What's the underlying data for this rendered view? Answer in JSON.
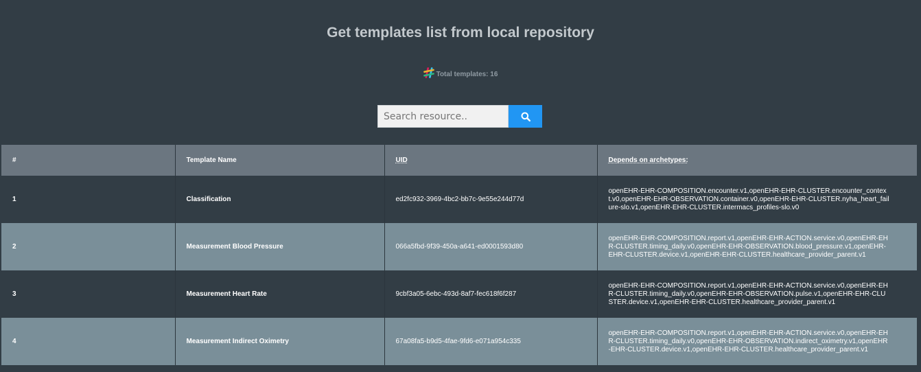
{
  "header": {
    "title": "Get templates list from local repository",
    "total_label": "Total templates: 16"
  },
  "search": {
    "placeholder": "Search resource..",
    "value": ""
  },
  "icons": {
    "logo": "slack-hash-icon",
    "search": "search-icon"
  },
  "colors": {
    "background": "#323d45",
    "header_row": "#6b7680",
    "alt_row": "#7a8f99",
    "search_button": "#2196f3"
  },
  "table": {
    "columns": [
      "#",
      "Template Name",
      "UID",
      "Depends on archetypes:"
    ],
    "rows": [
      {
        "num": "1",
        "name": "Classification",
        "uid": "ed2fc932-3969-4bc2-bb7c-9e55e244d77d",
        "deps": "openEHR-EHR-COMPOSITION.encounter.v1,openEHR-EHR-CLUSTER.encounter_context.v0,openEHR-EHR-OBSERVATION.container.v0,openEHR-EHR-CLUSTER.nyha_heart_failure-slo.v1,openEHR-EHR-CLUSTER.intermacs_profiles-slo.v0"
      },
      {
        "num": "2",
        "name": "Measurement Blood Pressure",
        "uid": "066a5fbd-9f39-450a-a641-ed0001593d80",
        "deps": "openEHR-EHR-COMPOSITION.report.v1,openEHR-EHR-ACTION.service.v0,openEHR-EHR-CLUSTER.timing_daily.v0,openEHR-EHR-OBSERVATION.blood_pressure.v1,openEHR-EHR-CLUSTER.device.v1,openEHR-EHR-CLUSTER.healthcare_provider_parent.v1"
      },
      {
        "num": "3",
        "name": "Measurement Heart Rate",
        "uid": "9cbf3a05-6ebc-493d-8af7-fec618f6f287",
        "deps": "openEHR-EHR-COMPOSITION.report.v1,openEHR-EHR-ACTION.service.v0,openEHR-EHR-CLUSTER.timing_daily.v0,openEHR-EHR-OBSERVATION.pulse.v1,openEHR-EHR-CLUSTER.device.v1,openEHR-EHR-CLUSTER.healthcare_provider_parent.v1"
      },
      {
        "num": "4",
        "name": "Measurement Indirect Oximetry",
        "uid": "67a08fa5-b9d5-4fae-9fd6-e071a954c335",
        "deps": "openEHR-EHR-COMPOSITION.report.v1,openEHR-EHR-ACTION.service.v0,openEHR-EHR-CLUSTER.timing_daily.v0,openEHR-EHR-OBSERVATION.indirect_oximetry.v1,openEHR-EHR-CLUSTER.device.v1,openEHR-EHR-CLUSTER.healthcare_provider_parent.v1"
      }
    ]
  }
}
